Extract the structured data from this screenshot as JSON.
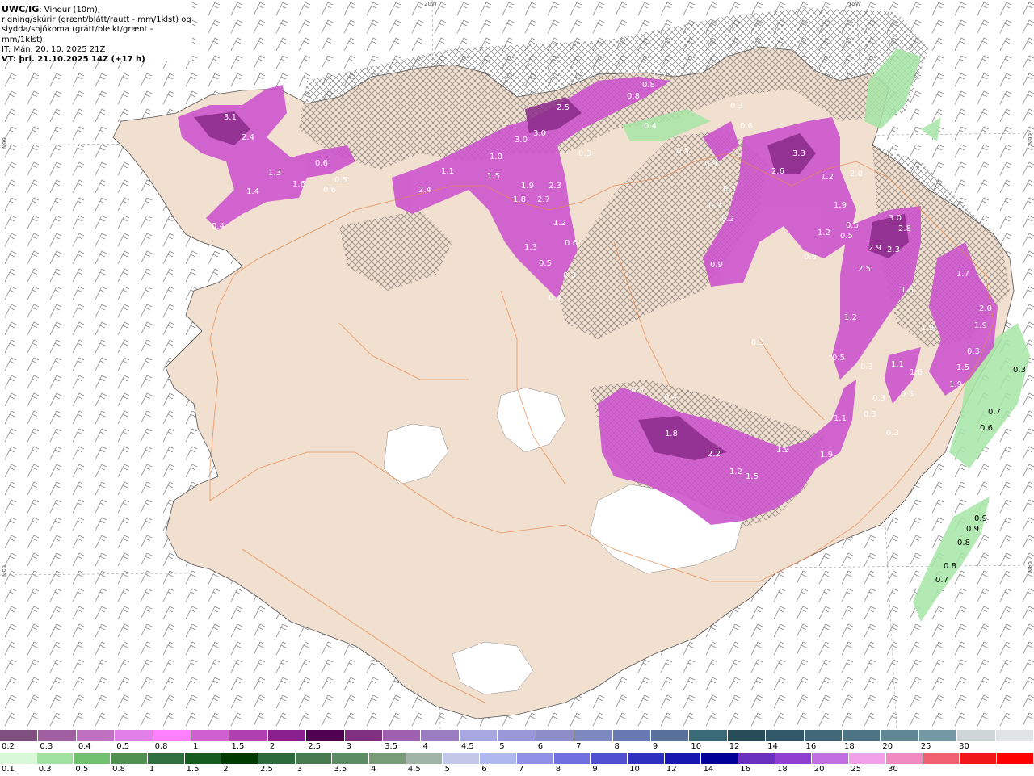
{
  "header": {
    "model": "UWC/IG",
    "line1": ": Vindur (10m),",
    "line2": "rigning/skúrir (grænt/blátt/rautt - mm/1klst) og",
    "line3": "slydda/snjókoma (grátt/bleikt/grænt - mm/1klst)",
    "it": "IT: Mán. 20. 10. 2025 21Z",
    "vt": "VT: þri. 21.10.2025 14Z (+17 h)"
  },
  "grid_labels": {
    "lon_20w": "20W",
    "lon_15w": "15W",
    "lat_66n_left": "66N",
    "lat_65n_left": "65N",
    "lat_66n_right": "66N",
    "lat_64n_right": "64N"
  },
  "precip_labels": [
    "3.1",
    "2.4",
    "1.3",
    "1.6",
    "1.4",
    "0.6",
    "0.5",
    "0.6",
    "0.4",
    "2.4",
    "1.1",
    "1.0",
    "1.5",
    "3.0",
    "3.0",
    "1.9",
    "1.8",
    "2.3",
    "2.7",
    "1.2",
    "1.3",
    "0.5",
    "0.6",
    "0.3",
    "0.4",
    "2.5",
    "0.8",
    "0.8",
    "0.2",
    "0.3",
    "0.4",
    "0.5",
    "0.9",
    "0.3",
    "0.6",
    "3.3",
    "2.6",
    "1.2",
    "2.0",
    "1.9",
    "0.5",
    "0.5",
    "1.2",
    "0.9",
    "0.3",
    "0.3",
    "0.2",
    "0.6",
    "3.0",
    "2.8",
    "2.9",
    "2.3",
    "2.5",
    "1.6",
    "1.2",
    "0.5",
    "1.7",
    "2.0",
    "1.9",
    "1.9",
    "0.3",
    "1.1",
    "1.6",
    "0.5",
    "0.3",
    "1.5",
    "1.9",
    "0.3",
    "0.3",
    "0.4",
    "0.3",
    "0.3",
    "1.8",
    "2.2",
    "1.2",
    "1.5",
    "1.9",
    "1.1",
    "1.9",
    "0.3",
    "0.7",
    "0.6",
    "0.3",
    "0.9",
    "0.9",
    "0.8",
    "0.8",
    "0.7"
  ],
  "legend": {
    "snow_colors": [
      "#7f4f7f",
      "#a05fa0",
      "#c070c0",
      "#e080e8",
      "#ff80ff",
      "#d060d0",
      "#b040b0",
      "#8a2090",
      "#500050",
      "#803080",
      "#a060b0",
      "#9a7cc0",
      "#a8a8e0",
      "#9898d8",
      "#8c8cc8",
      "#7c88c0",
      "#6878b0",
      "#58709c",
      "#386a78",
      "#284c58",
      "#305868",
      "#406878",
      "#4c7484",
      "#608894",
      "#7498a4",
      "#cfd6d8",
      "#e0e4e4"
    ],
    "snow_labels": [
      "0.2",
      "0.3",
      "0.4",
      "0.5",
      "0.8",
      "1",
      "1.5",
      "2",
      "2.5",
      "3",
      "3.5",
      "4",
      "4.5",
      "5",
      "6",
      "7",
      "8",
      "9",
      "10",
      "12",
      "14",
      "16",
      "18",
      "20",
      "25",
      "30"
    ],
    "rain_colors": [
      "#d8f8d8",
      "#a0e0a0",
      "#70c070",
      "#509050",
      "#2f7040",
      "#145c20",
      "#003c00",
      "#2c6a3c",
      "#487a50",
      "#5c8c64",
      "#789c78",
      "#a0b4a8",
      "#c4c8e8",
      "#b0b8f0",
      "#9090e8",
      "#7070e0",
      "#5050d0",
      "#3030c0",
      "#1818b0",
      "#000098",
      "#6a30c0",
      "#9040d0",
      "#c070e0",
      "#f0a0e8",
      "#f08ac0",
      "#f06070",
      "#f01818",
      "#ff0000"
    ],
    "rain_labels": [
      "0.1",
      "0.3",
      "0.5",
      "0.8",
      "1",
      "1.5",
      "2",
      "2.5",
      "3",
      "3.5",
      "4",
      "4.5",
      "5",
      "6",
      "7",
      "8",
      "9",
      "10",
      "12",
      "14",
      "16",
      "18",
      "20",
      "25",
      "30"
    ]
  }
}
